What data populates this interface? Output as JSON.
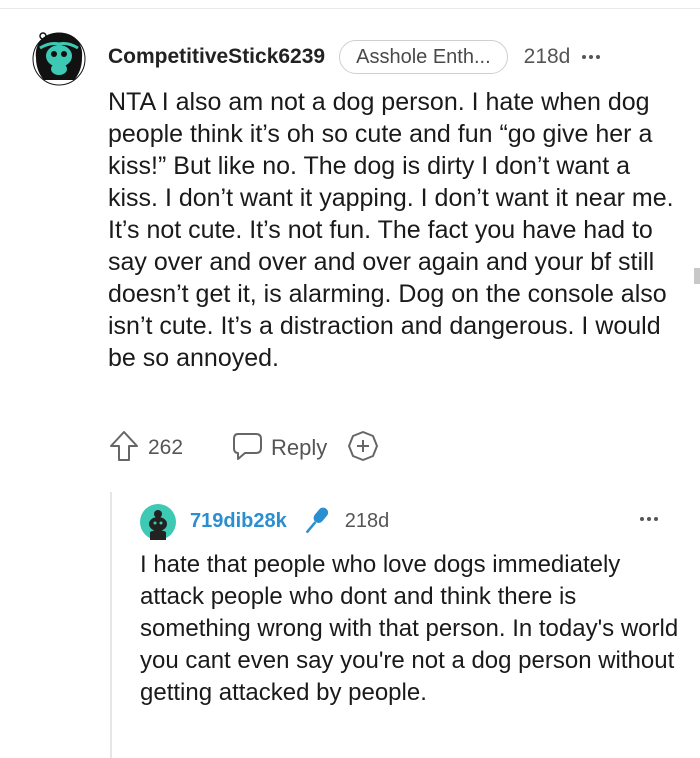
{
  "comment": {
    "username": "CompetitiveStick6239",
    "flair": "Asshole Enth...",
    "age": "218d",
    "body": "NTA I also am not a dog person. I hate when dog people think it’s oh so cute and fun “go give her a kiss!” But like no. The dog is dirty I don’t want a kiss. I don’t want it yapping. I don’t want it near me. It’s not cute. It’s not fun. The fact you have had to say over and over and over again and your bf still doesn’t get it, is alarming. Dog on the console also isn’t cute. It’s a distraction and dangerous. I would be so annoyed.",
    "upvotes": "262",
    "reply_label": "Reply"
  },
  "reply": {
    "username": "719dib28k",
    "age": "218d",
    "body": "I hate that people who love dogs immediately attack people who dont and think there is something wrong with that person. In today's world you cant even say you're not a dog person without getting attacked by people."
  },
  "colors": {
    "reply_username": "#2a8fd0",
    "avatar_teal": "#3ec9b5",
    "text": "#1a1a1a",
    "muted": "#555555"
  },
  "icons": [
    "more-options-icon",
    "upvote-arrow-icon",
    "reply-bubble-icon",
    "award-plus-icon",
    "microphone-icon"
  ]
}
